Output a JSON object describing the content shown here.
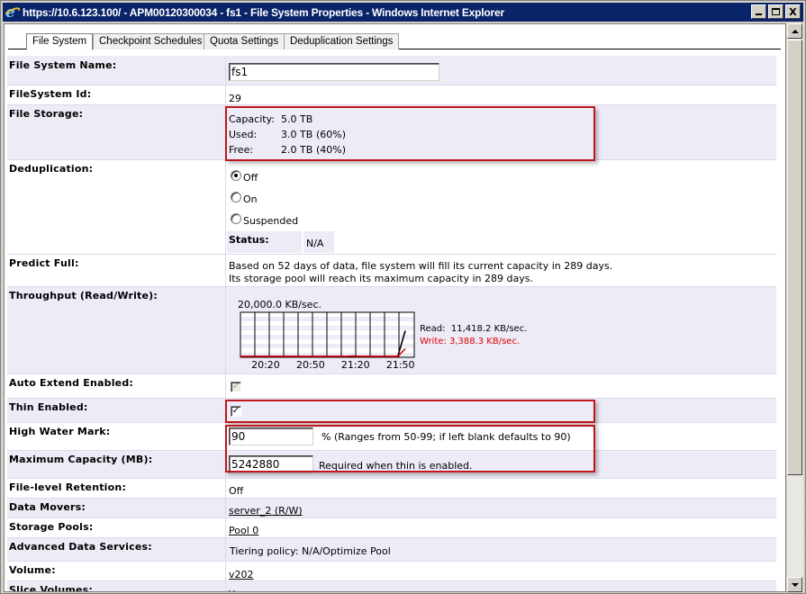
{
  "window": {
    "title": "https://10.6.123.100/ - APM00120300034 - fs1 - File System Properties - Windows Internet Explorer",
    "controls": [
      "minimize",
      "maximize",
      "close"
    ],
    "close_glyph": "X"
  },
  "tabs": [
    {
      "label": "File System",
      "active": true
    },
    {
      "label": "Checkpoint Schedules",
      "active": false
    },
    {
      "label": "Quota Settings",
      "active": false
    },
    {
      "label": "Deduplication Settings",
      "active": false
    }
  ],
  "fields": {
    "fs_name": {
      "label": "File System Name:",
      "value": "fs1"
    },
    "fs_id": {
      "label": "FileSystem Id:",
      "value": "29"
    },
    "storage": {
      "label": "File Storage:",
      "capacity_label": "Capacity:",
      "capacity": "5.0 TB",
      "used_label": "Used:",
      "used": "3.0 TB",
      "used_pct": "(60%)",
      "free_label": "Free:",
      "free": "2.0 TB",
      "free_pct": "(40%)"
    },
    "dedup": {
      "label": "Deduplication:",
      "options": [
        {
          "label": "Off",
          "selected": true
        },
        {
          "label": "On",
          "selected": false
        },
        {
          "label": "Suspended",
          "selected": false
        }
      ],
      "status_label": "Status:",
      "status_value": "N/A"
    },
    "predict": {
      "label": "Predict Full:",
      "line1": "Based on 52 days of data, file system will fill its current capacity in 289 days.",
      "line2": "Its storage pool will reach its maximum capacity in 289 days."
    },
    "throughput": {
      "label": "Throughput (Read/Write):",
      "read_text": "Read:  11,418.2 KB/sec.",
      "write_text": "Write: 3,388.3 KB/sec."
    },
    "auto_extend": {
      "label": "Auto Extend Enabled:",
      "checked": true,
      "disabled": true
    },
    "thin": {
      "label": "Thin Enabled:",
      "checked": true
    },
    "hwm": {
      "label": "High Water Mark:",
      "value": "90",
      "hint": "% (Ranges from 50-99; if left blank defaults to 90)"
    },
    "max_cap": {
      "label": "Maximum Capacity (MB):",
      "value": "5242880",
      "hint": "Required when thin is enabled."
    },
    "retention": {
      "label": "File-level Retention:",
      "value": "Off"
    },
    "movers": {
      "label": "Data Movers:",
      "value": "server_2 (R/W)"
    },
    "pools": {
      "label": "Storage Pools:",
      "value": "Pool 0"
    },
    "ads": {
      "label": "Advanced Data Services:",
      "value": "Tiering policy: N/A/Optimize Pool"
    },
    "volume": {
      "label": "Volume:",
      "value": "v202"
    },
    "slice": {
      "label": "Slice Volumes:",
      "value": "Y"
    }
  },
  "chart_data": {
    "type": "line",
    "title": "20,000.0 KB/sec.",
    "ylabel": "KB/sec.",
    "ylim": [
      0,
      20000
    ],
    "x_tick_labels": [
      "20:20",
      "20:50",
      "21:20",
      "21:50"
    ],
    "x": [
      "20:05",
      "20:10",
      "20:15",
      "20:20",
      "20:25",
      "20:30",
      "20:35",
      "20:40",
      "20:45",
      "20:50",
      "20:55",
      "21:00",
      "21:05",
      "21:10",
      "21:15",
      "21:20",
      "21:25",
      "21:30",
      "21:35",
      "21:40",
      "21:45",
      "21:50",
      "21:55"
    ],
    "series": [
      {
        "name": "Read",
        "color": "#000000",
        "current": "11,418.2 KB/sec.",
        "values": [
          0,
          0,
          0,
          0,
          0,
          0,
          0,
          0,
          0,
          0,
          0,
          0,
          0,
          0,
          0,
          0,
          0,
          0,
          0,
          0,
          0,
          0,
          11418.2
        ]
      },
      {
        "name": "Write",
        "color": "#e00000",
        "current": "3,388.3 KB/sec.",
        "values": [
          0,
          0,
          0,
          0,
          0,
          0,
          0,
          0,
          0,
          0,
          0,
          0,
          0,
          0,
          0,
          200,
          0,
          0,
          0,
          0,
          0,
          0,
          3388.3
        ]
      }
    ],
    "grid": true,
    "legend": "right"
  }
}
